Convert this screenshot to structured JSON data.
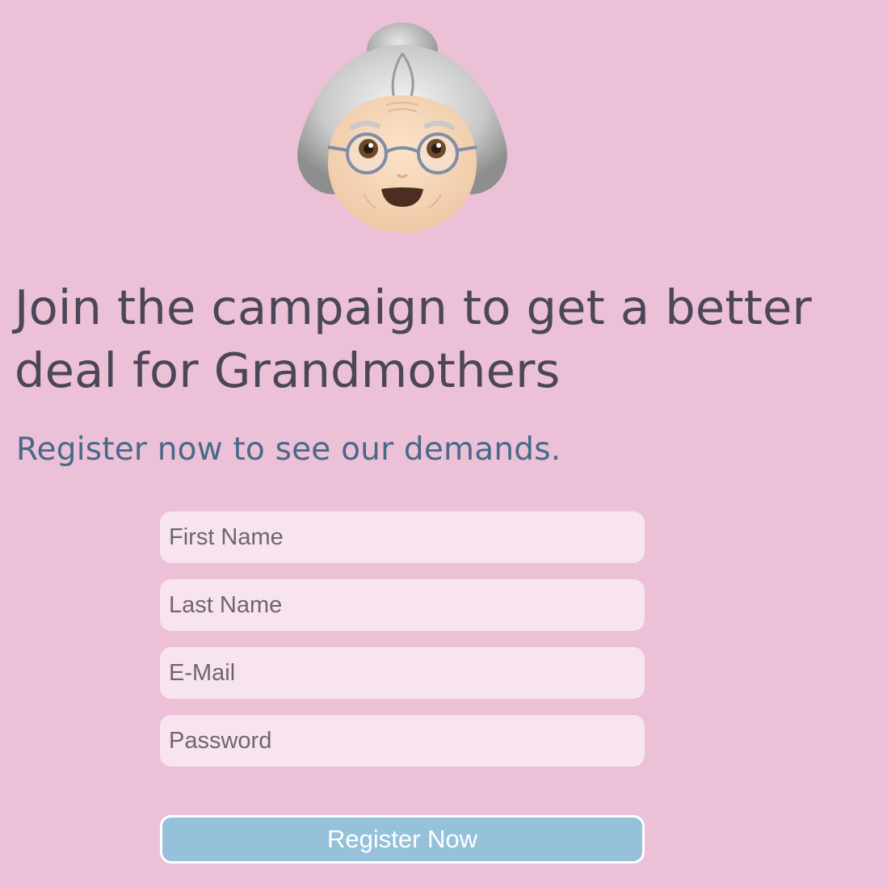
{
  "hero": {
    "avatar_icon": "old-woman-emoji",
    "headline": "Join the campaign to get a better deal for Grandmothers",
    "subheadline": "Register now to see our demands."
  },
  "form": {
    "first_name": {
      "placeholder": "First Name",
      "value": ""
    },
    "last_name": {
      "placeholder": "Last Name",
      "value": ""
    },
    "email": {
      "placeholder": "E-Mail",
      "value": ""
    },
    "password": {
      "placeholder": "Password",
      "value": ""
    },
    "submit_label": "Register Now"
  },
  "colors": {
    "background": "#ecc0d6",
    "headline": "#4b4658",
    "subheadline": "#48698a",
    "field_bg": "#f8e4ee",
    "button_bg": "#95c2da",
    "button_text": "#ffffff"
  }
}
